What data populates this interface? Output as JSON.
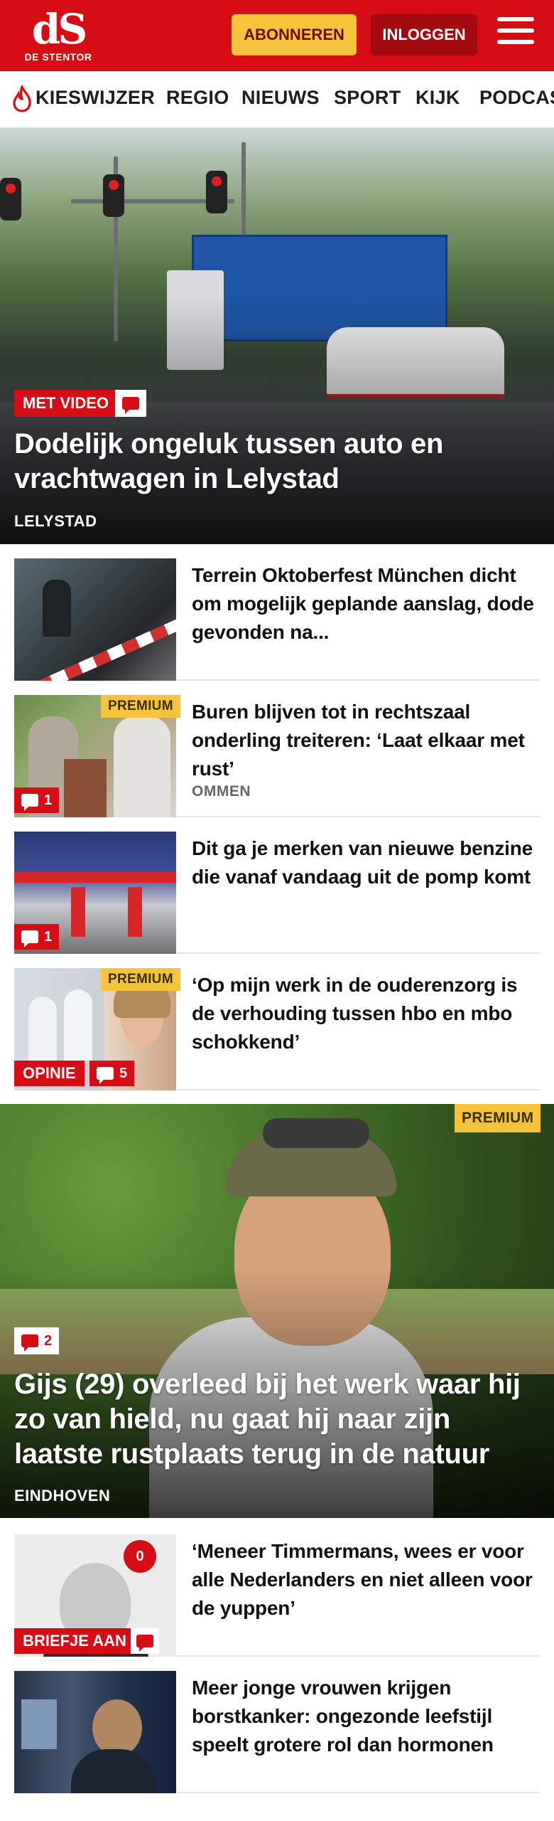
{
  "header": {
    "logo_mark": "dS",
    "logo_sub": "DE STENTOR",
    "subscribe_label": "ABONNEREN",
    "login_label": "INLOGGEN",
    "brand_red": "#d60d14",
    "accent_yellow": "#f5c43c"
  },
  "nav": {
    "items": [
      "KIESWIJZER",
      "REGIO",
      "NIEUWS",
      "SPORT",
      "KIJK",
      "PODCAS"
    ]
  },
  "hero1": {
    "badge": "MET VIDEO",
    "title": "Dodelijk ongeluk tussen auto en vrachtwagen in Lelystad",
    "location": "LELYSTAD"
  },
  "articles1": [
    {
      "title": "Terrein Oktoberfest München dicht om mogelijk geplande aanslag, dode gevonden na..."
    },
    {
      "title": "Buren blijven tot in rechtszaal onderling treiteren: ‘Laat elkaar met rust’",
      "location": "OMMEN",
      "premium": "PREMIUM",
      "comments": "1"
    },
    {
      "title": "Dit ga je merken van nieuwe benzine die vanaf vandaag uit de pomp komt",
      "comments": "1"
    },
    {
      "title": "‘Op mijn werk in de ouderenzorg is de verhouding tussen hbo en mbo schokkend’",
      "premium": "PREMIUM",
      "label": "OPINIE",
      "comments": "5"
    }
  ],
  "hero2": {
    "premium": "PREMIUM",
    "comments": "2",
    "title": "Gijs (29) overleed bij het werk waar hij zo van hield, nu gaat hij naar zijn laatste rustplaats terug in de natuur",
    "location": "EINDHOVEN"
  },
  "articles2": [
    {
      "title": "‘Meneer Timmermans, wees er voor alle Nederlanders en niet alleen voor de yuppen’",
      "label": "BRIEFJE AAN",
      "count_badge": "0"
    },
    {
      "title": "Meer jonge vrouwen krijgen borstkanker: ongezonde leefstijl speelt grotere rol dan hormonen"
    }
  ]
}
